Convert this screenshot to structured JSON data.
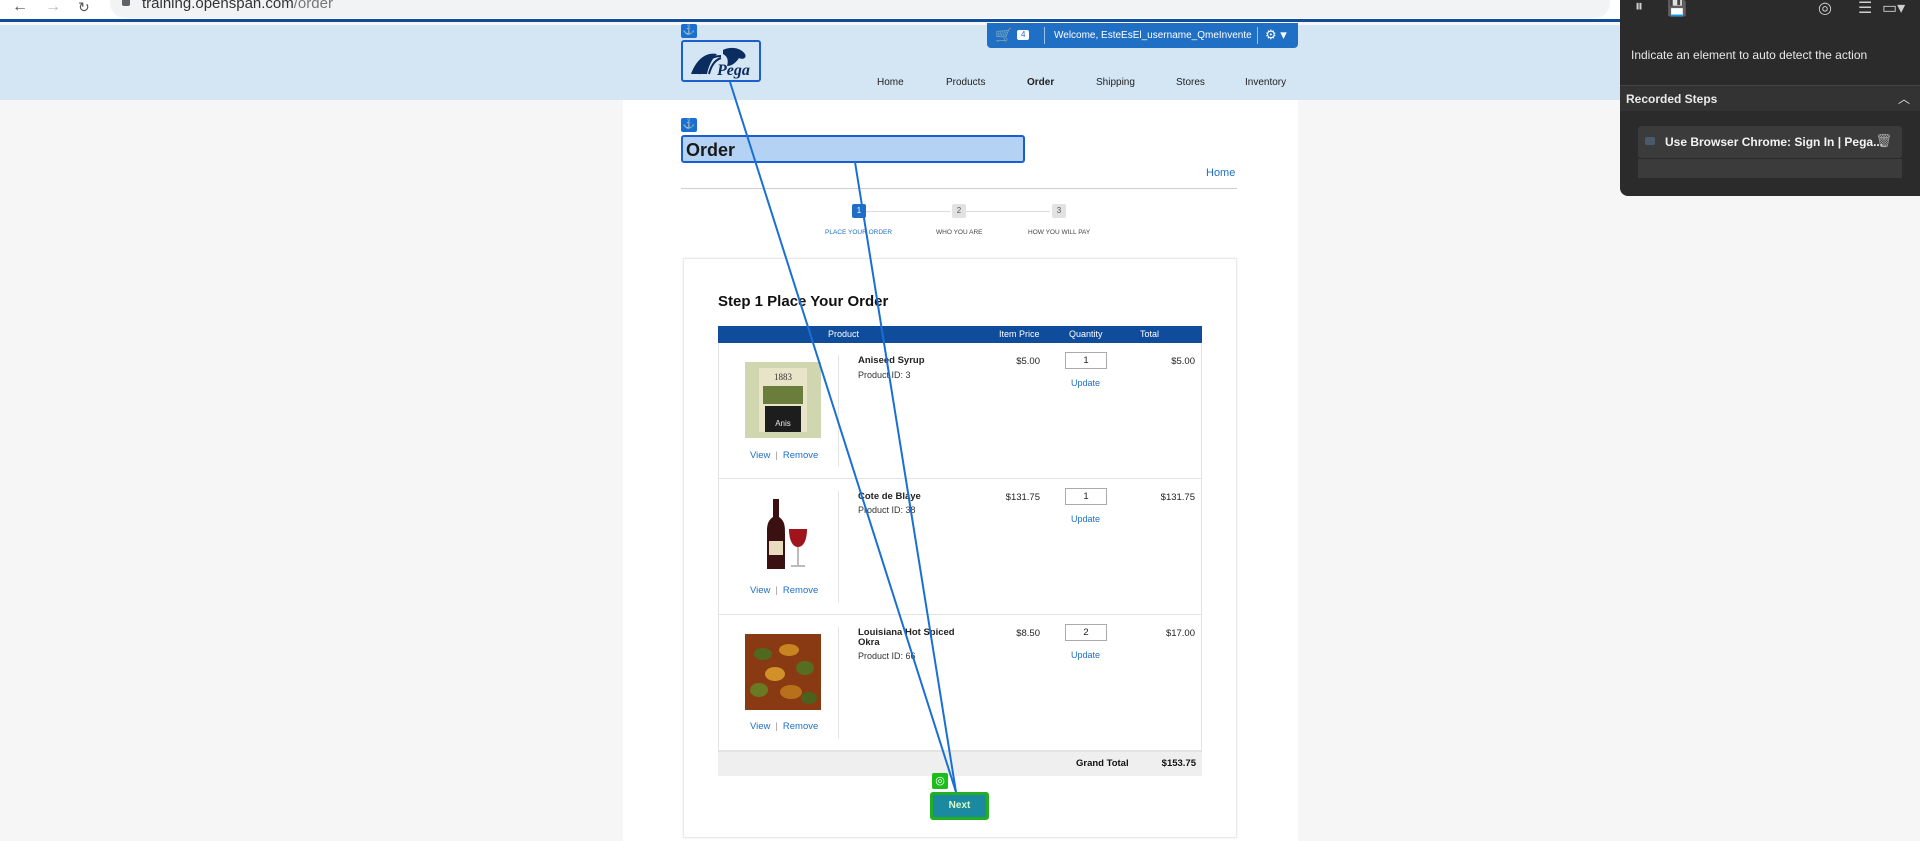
{
  "browser": {
    "url_domain": "training.openspan.com",
    "url_path": "/order"
  },
  "header": {
    "logo_text": "Pega",
    "cart_count": "4",
    "welcome": "Welcome, EsteEsEl_username_QmeInvente",
    "nav": [
      "Home",
      "Products",
      "Order",
      "Shipping",
      "Stores",
      "Inventory"
    ]
  },
  "page": {
    "title": "Order",
    "home_link": "Home"
  },
  "steps": [
    {
      "num": "1",
      "label": "PLACE YOUR ORDER",
      "active": true
    },
    {
      "num": "2",
      "label": "WHO YOU ARE",
      "active": false
    },
    {
      "num": "3",
      "label": "HOW YOU WILL PAY",
      "active": false
    }
  ],
  "order": {
    "title": "Step 1 Place Your Order",
    "columns": [
      "Product",
      "Item Price",
      "Quantity",
      "Total"
    ],
    "rows": [
      {
        "name": "Aniseed Syrup",
        "product_id": "Product ID: 3",
        "price": "$5.00",
        "qty": "1",
        "total": "$5.00",
        "update": "Update",
        "view": "View",
        "remove": "Remove",
        "image": "syrup-bottle-image"
      },
      {
        "name": "Cote de Blaye",
        "product_id": "Product ID: 38",
        "price": "$131.75",
        "qty": "1",
        "total": "$131.75",
        "update": "Update",
        "view": "View",
        "remove": "Remove",
        "image": "wine-bottle-image"
      },
      {
        "name": "Louisiana Hot Spiced Okra",
        "product_id": "Product ID: 66",
        "price": "$8.50",
        "qty": "2",
        "total": "$17.00",
        "update": "Update",
        "view": "View",
        "remove": "Remove",
        "image": "okra-dish-image"
      }
    ],
    "grand_total_label": "Grand Total",
    "grand_total_value": "$153.75",
    "next_button": "Next"
  },
  "recorder": {
    "hint": "Indicate an element to auto detect the action",
    "section_title": "Recorded Steps",
    "step_text": "Use Browser Chrome: Sign In | Pega..."
  },
  "colors": {
    "header_band": "#d4e5f3",
    "brand_blue": "#1f6fc5",
    "table_header": "#0f4d9c",
    "highlight_green": "#22b022",
    "recorder_bg": "#2b2b2b"
  }
}
